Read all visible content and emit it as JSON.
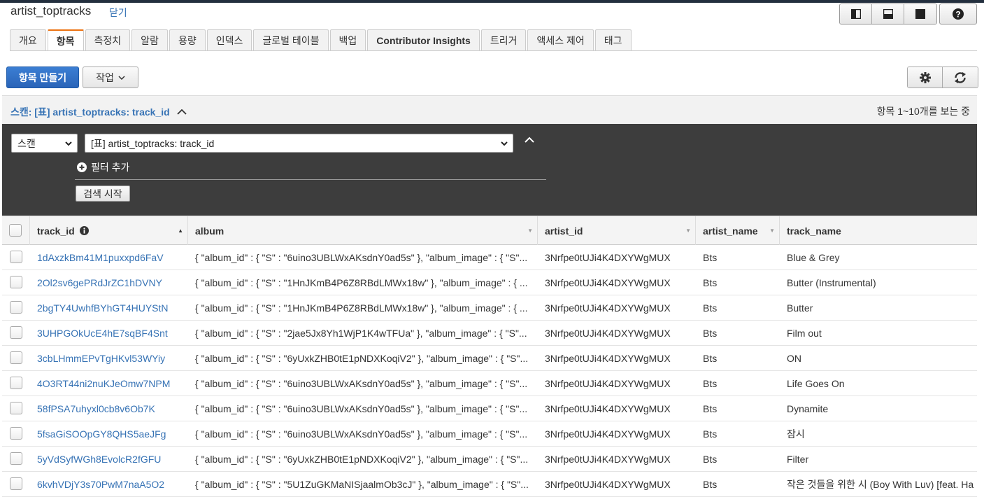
{
  "header": {
    "title": "artist_toptracks",
    "close_label": "닫기"
  },
  "tabs": [
    {
      "label": "개요"
    },
    {
      "label": "항목"
    },
    {
      "label": "측정치"
    },
    {
      "label": "알람"
    },
    {
      "label": "용량"
    },
    {
      "label": "인덱스"
    },
    {
      "label": "글로벌 테이블"
    },
    {
      "label": "백업"
    },
    {
      "label": "Contributor Insights"
    },
    {
      "label": "트리거"
    },
    {
      "label": "액세스 제어"
    },
    {
      "label": "태그"
    }
  ],
  "toolbar": {
    "create_label": "항목 만들기",
    "action_label": "작업"
  },
  "scan": {
    "header_title": "스캔: [표] artist_toptracks: track_id",
    "status": "항목 1~10개를 보는 중",
    "mode_value": "스캔",
    "target_value": "[표] artist_toptracks: track_id",
    "add_filter_label": "필터 추가",
    "search_label": "검색 시작"
  },
  "table": {
    "columns": [
      "track_id",
      "album",
      "artist_id",
      "artist_name",
      "track_name"
    ],
    "rows": [
      {
        "track_id": "1dAxzkBm41M1puxxpd6FaV",
        "album": "{ \"album_id\" : { \"S\" : \"6uino3UBLWxAKsdnY0ad5s\" }, \"album_image\" : { \"S\"...",
        "artist_id": "3Nrfpe0tUJi4K4DXYWgMUX",
        "artist_name": "Bts",
        "track_name": "Blue & Grey"
      },
      {
        "track_id": "2Ol2sv6gePRdJrZC1hDVNY",
        "album": "{ \"album_id\" : { \"S\" : \"1HnJKmB4P6Z8RBdLMWx18w\" }, \"album_image\" : { ...",
        "artist_id": "3Nrfpe0tUJi4K4DXYWgMUX",
        "artist_name": "Bts",
        "track_name": "Butter (Instrumental)"
      },
      {
        "track_id": "2bgTY4UwhfBYhGT4HUYStN",
        "album": "{ \"album_id\" : { \"S\" : \"1HnJKmB4P6Z8RBdLMWx18w\" }, \"album_image\" : { ...",
        "artist_id": "3Nrfpe0tUJi4K4DXYWgMUX",
        "artist_name": "Bts",
        "track_name": "Butter"
      },
      {
        "track_id": "3UHPGOkUcE4hE7sqBF4Snt",
        "album": "{ \"album_id\" : { \"S\" : \"2jae5Jx8Yh1WjP1K4wTFUa\" }, \"album_image\" : { \"S\"...",
        "artist_id": "3Nrfpe0tUJi4K4DXYWgMUX",
        "artist_name": "Bts",
        "track_name": "Film out"
      },
      {
        "track_id": "3cbLHmmEPvTgHKvl53WYiy",
        "album": "{ \"album_id\" : { \"S\" : \"6yUxkZHB0tE1pNDXKoqiV2\" }, \"album_image\" : { \"S\"...",
        "artist_id": "3Nrfpe0tUJi4K4DXYWgMUX",
        "artist_name": "Bts",
        "track_name": "ON"
      },
      {
        "track_id": "4O3RT44ni2nuKJeOmw7NPM",
        "album": "{ \"album_id\" : { \"S\" : \"6uino3UBLWxAKsdnY0ad5s\" }, \"album_image\" : { \"S\"...",
        "artist_id": "3Nrfpe0tUJi4K4DXYWgMUX",
        "artist_name": "Bts",
        "track_name": "Life Goes On"
      },
      {
        "track_id": "58fPSA7uhyxl0cb8v6Ob7K",
        "album": "{ \"album_id\" : { \"S\" : \"6uino3UBLWxAKsdnY0ad5s\" }, \"album_image\" : { \"S\"...",
        "artist_id": "3Nrfpe0tUJi4K4DXYWgMUX",
        "artist_name": "Bts",
        "track_name": "Dynamite"
      },
      {
        "track_id": "5fsaGiSOOpGY8QHS5aeJFg",
        "album": "{ \"album_id\" : { \"S\" : \"6uino3UBLWxAKsdnY0ad5s\" }, \"album_image\" : { \"S\"...",
        "artist_id": "3Nrfpe0tUJi4K4DXYWgMUX",
        "artist_name": "Bts",
        "track_name": "잠시"
      },
      {
        "track_id": "5yVdSyfWGh8EvolcR2fGFU",
        "album": "{ \"album_id\" : { \"S\" : \"6yUxkZHB0tE1pNDXKoqiV2\" }, \"album_image\" : { \"S\"...",
        "artist_id": "3Nrfpe0tUJi4K4DXYWgMUX",
        "artist_name": "Bts",
        "track_name": "Filter"
      },
      {
        "track_id": "6kvhVDjY3s70PwM7naA5O2",
        "album": "{ \"album_id\" : { \"S\" : \"5U1ZuGKMaNISjaalmOb3cJ\" }, \"album_image\" : { \"S\"...",
        "artist_id": "3Nrfpe0tUJi4K4DXYWgMUX",
        "artist_name": "Bts",
        "track_name": "작은 것들을 위한 시 (Boy With Luv) [feat. Ha"
      }
    ]
  },
  "colors": {
    "accent": "#ec7211",
    "link": "#3773b5",
    "primary_button": "#2a64b8",
    "scan_panel": "#3d3d3d"
  }
}
